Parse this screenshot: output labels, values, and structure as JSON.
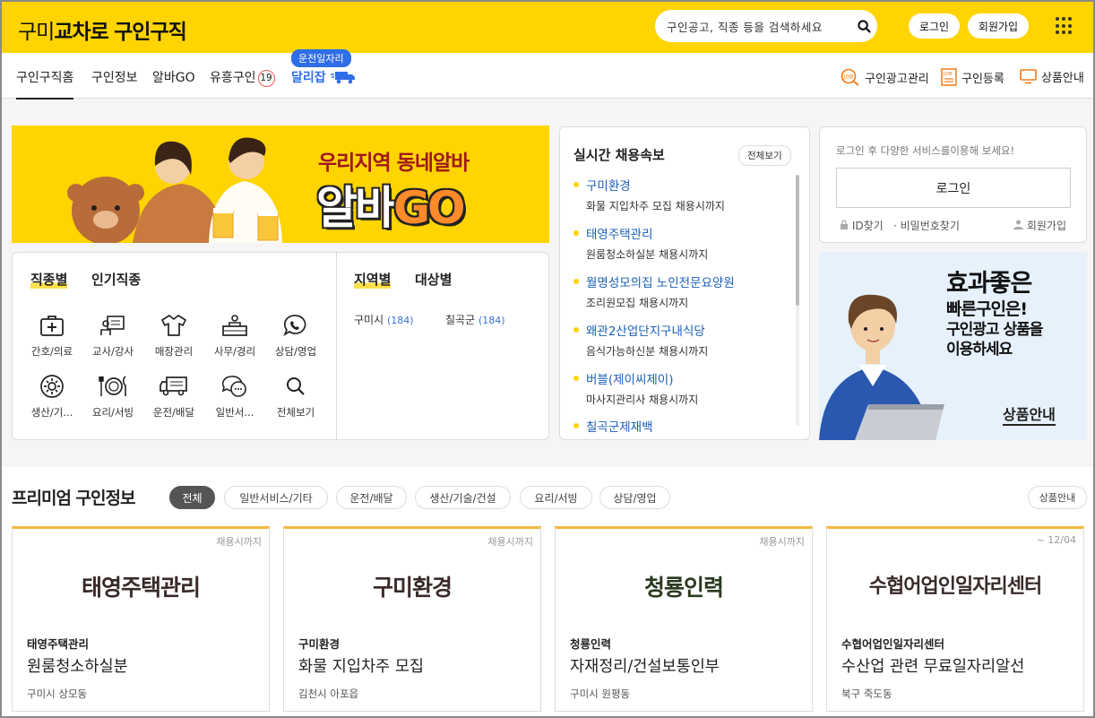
{
  "header": {
    "logo_prefix": "구미",
    "logo_brand": "교차로",
    "logo_suffix": "구인구직",
    "search_placeholder": "구인공고, 직종 등을 검색하세요",
    "login": "로그인",
    "signup": "회원가입"
  },
  "nav": {
    "items": [
      "구인구직홈",
      "구인정보",
      "알바GO",
      "유흥구인",
      "달리잡"
    ],
    "adult_badge": "19",
    "dali_tag": "운전일자리",
    "right": [
      "구인광고관리",
      "구인등록",
      "상품안내"
    ]
  },
  "banner": {
    "line1": "우리지역 동네알바",
    "line2_a": "알바",
    "line2_b": "GO"
  },
  "categories": {
    "tabs": [
      "직종별",
      "인기직종"
    ],
    "region_tabs": [
      "지역별",
      "대상별"
    ],
    "items": [
      "간호/의료",
      "교사/강사",
      "매장관리",
      "사무/경리",
      "상담/영업",
      "생산/기...",
      "요리/서빙",
      "운전/배달",
      "일반서...",
      "전체보기"
    ],
    "regions": [
      {
        "name": "구미시",
        "count": "(184)"
      },
      {
        "name": "칠곡군",
        "count": "(184)"
      }
    ]
  },
  "realtime": {
    "title": "실시간 채용속보",
    "more": "전체보기",
    "items": [
      {
        "name": "구미환경",
        "desc": "화물 지입차주 모집 채용시까지"
      },
      {
        "name": "태영주택관리",
        "desc": "원룸청소하실분 채용시까지"
      },
      {
        "name": "월명성모의집 노인전문요양원",
        "desc": "조리원모집 채용시까지"
      },
      {
        "name": "왜관2산업단지구내식당",
        "desc": "음식가능하신분 채용시까지"
      },
      {
        "name": "버블(제이씨제이)",
        "desc": "마사지관리사 채용시까지"
      },
      {
        "name": "칠곡군제재백",
        "desc": ""
      }
    ]
  },
  "login_box": {
    "message": "로그인 후 다양한 서비스를이용해 보세요!",
    "button": "로그인",
    "id_find": "ID찾기",
    "pw_find": "비밀번호찾기",
    "signup": "회원가입"
  },
  "ad": {
    "line1": "효과좋은",
    "line2": "빠른구인은!",
    "line3": "구인광고 상품을",
    "line4": "이용하세요",
    "cta": "상품안내"
  },
  "premium": {
    "title": "프리미엄 구인정보",
    "chips": [
      "전체",
      "일반서비스/기타",
      "운전/배달",
      "생산/기술/건설",
      "요리/서빙",
      "상담/영업"
    ],
    "product_button": "상품안내",
    "cards": [
      {
        "when": "채용시까지",
        "big": "태영주택관리",
        "company": "태영주택관리",
        "title": "원룸청소하실분",
        "location": "구미시 상모동"
      },
      {
        "when": "채용시까지",
        "big": "구미환경",
        "company": "구미환경",
        "title": "화물 지입차주 모집",
        "location": "김천시 아포읍"
      },
      {
        "when": "채용시까지",
        "big": "청룡인력",
        "company": "청룡인력",
        "title": "자재정리/건설보통인부",
        "location": "구미시 원평동"
      },
      {
        "when": "~ 12/04",
        "big": "수협어업인일자리센터",
        "company": "수협어업인일자리센터",
        "title": "수산업 관련 무료일자리알선",
        "location": "북구 죽도동"
      }
    ]
  },
  "colors": {
    "brand_yellow": "#ffd400",
    "link_blue": "#1b5fb8",
    "card_top": "#f4b942"
  }
}
